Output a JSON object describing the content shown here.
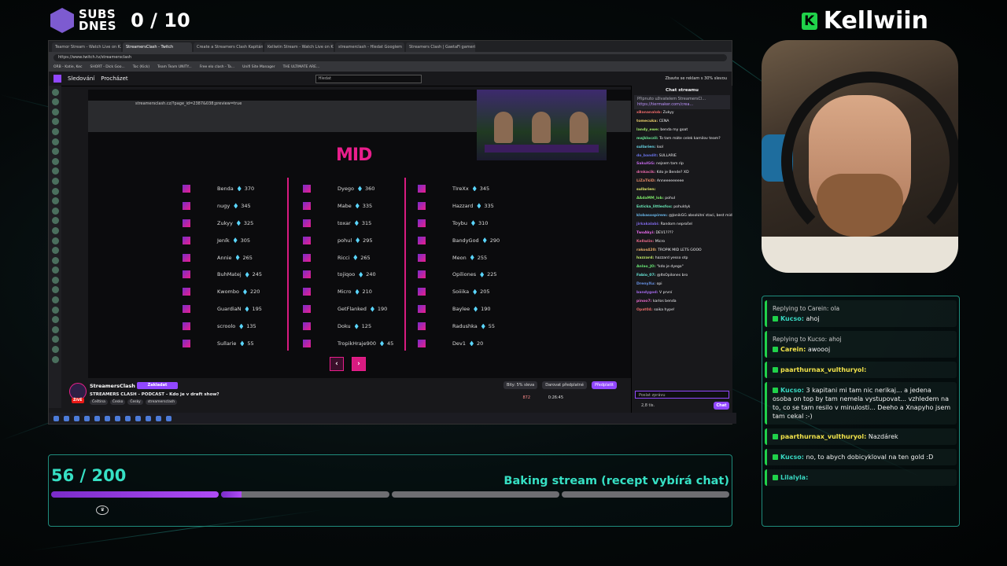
{
  "overlay": {
    "subs_label_1": "SUBS",
    "subs_label_2": "DNES",
    "subs_count": "0 / 10",
    "brand": "Kellwiin",
    "brand_icon": "K",
    "goal_progress": "56 / 200",
    "goal_fraction": 0.28,
    "goal_title": "Baking stream (recept vybírá chat)",
    "accent_color": "#36e0c4",
    "brand_color": "#20d14a"
  },
  "browser": {
    "tabs": [
      "Teamor Stream - Watch Live on K...",
      "StreamersClash - Twitch",
      "Create a Streamers Clash Kapitán",
      "Kellwiin Stream - Watch Live on K",
      "streamerclash - Hledat Googlem",
      "Streamers Clash | GaetaFi gameri..."
    ],
    "url": "https://www.twitch.tv/streamersclash",
    "bookmarks": [
      "ORB - Katie, Kec",
      "SHORT - Dick Goo...",
      "Toc (Kick)",
      "Team Team UNITY...",
      "Free elo clash - Ta...",
      "Unifi Site Manager",
      "THE ULTIMATE ARE..."
    ]
  },
  "twitch": {
    "nav_following": "Sledování",
    "nav_browse": "Procházet",
    "search_placeholder": "Hledat",
    "promo": "Zbavte se reklam s 30% slevou",
    "inner_url": "streamersclash.cz/?page_id=2387&038;preview=true",
    "mid_title": "MID",
    "columns": [
      [
        [
          "Benda",
          "370"
        ],
        [
          "nugy",
          "345"
        ],
        [
          "Zukyy",
          "325"
        ],
        [
          "Jeník",
          "305"
        ],
        [
          "Annie",
          "265"
        ],
        [
          "BuhMatej",
          "245"
        ],
        [
          "Kwombo",
          "220"
        ],
        [
          "GuardiaN",
          "195"
        ],
        [
          "scroolo",
          "135"
        ],
        [
          "Sullarie",
          "55"
        ]
      ],
      [
        [
          "Dyego",
          "360"
        ],
        [
          "Mabe",
          "335"
        ],
        [
          "toxar",
          "315"
        ],
        [
          "pohul",
          "295"
        ],
        [
          "Ricci",
          "265"
        ],
        [
          "tojiqoo",
          "240"
        ],
        [
          "Micro",
          "210"
        ],
        [
          "GetFlanked",
          "190"
        ],
        [
          "Doku",
          "125"
        ],
        [
          "TropikHraje900",
          "45"
        ]
      ],
      [
        [
          "TIreXx",
          "345"
        ],
        [
          "Hazzard",
          "335"
        ],
        [
          "Toybu",
          "310"
        ],
        [
          "BandyGod",
          "290"
        ],
        [
          "Meon",
          "255"
        ],
        [
          "Opiliones",
          "225"
        ],
        [
          "Soiiika",
          "205"
        ],
        [
          "Baylee",
          "190"
        ],
        [
          "Radushka",
          "55"
        ],
        [
          "Dev1",
          "20"
        ]
      ]
    ],
    "prev_label": "‹",
    "next_label": "›",
    "channel": "StreamersClash",
    "follow_label": "Zakladat",
    "stream_title": "STREAMERS CLASH - PODCAST - Kdo je v draft show?",
    "live_label": "ŽIVĚ",
    "tags": [
      "Čeština",
      "Česko",
      "Česky",
      "streamersclash"
    ],
    "viewers": "872",
    "uptime": "0:26:45",
    "bits_label": "Bity: 5% sleva",
    "gift_label": "Darovat předplatné",
    "sub_label": "Předplatit"
  },
  "twitch_chat": {
    "title": "Chat streamu",
    "pinned_by": "Připnuto uživatelem StreamersCl...",
    "pinned_link": "https://tiermaker.com/crea...",
    "messages": [
      [
        "xBananalob:",
        "Zukyy"
      ],
      [
        "tomecuka:",
        "CENA"
      ],
      [
        "landy_ewe:",
        "benda my goat"
      ],
      [
        "majkloczil:",
        "To tam máte celek kamilov team?"
      ],
      [
        "sullarien:",
        "lool"
      ],
      [
        "do_bandit:",
        "SULLARIE"
      ],
      [
        "SakulGG:",
        "nejsem tam rip"
      ],
      [
        "drnkacik:",
        "Kdo je Bende? XD"
      ],
      [
        "LiZaTkiD:",
        "Anneeeeeeeee"
      ],
      [
        "sullarien:",
        ""
      ],
      [
        "AAdaMM_lob:",
        "pohul"
      ],
      [
        "Esticka_littlesfox:",
        "pohuldyk"
      ],
      [
        "klobasospirem:",
        "@JonikGG absolútní staci, best midlaner na seznamu"
      ],
      [
        "jirkakalabi:",
        "Random neprošel"
      ],
      [
        "TwoAkyi:",
        "DEV1????"
      ],
      [
        "Kellwiin:",
        "Micro"
      ],
      [
        "rakos420:",
        "TROPIK MID LETS GOOO"
      ],
      [
        "hazzard:",
        "hazzard yesso otp"
      ],
      [
        "Anlao_JO:",
        "\"kdo je dyego\""
      ],
      [
        "Fabio_07:",
        "@ItsOpilones bro"
      ],
      [
        "DrenyXu:",
        "opi"
      ],
      [
        "bandygod:",
        "V první"
      ],
      [
        "pinoo7:",
        "karlos benda"
      ],
      [
        "Opat04:",
        "soika hype!"
      ]
    ],
    "input_placeholder": "Poslat zprávu",
    "points": "2,8 tis.",
    "chat_button": "Chat"
  },
  "overlay_chat": [
    {
      "reply": "Replying to Carein: ola",
      "user": "Kucso:",
      "text": "ahoj",
      "color": "#38d6c0"
    },
    {
      "reply": "Replying to Kucso: ahoj",
      "user": "Carein:",
      "text": "awoooj",
      "color": "#f2e34a"
    },
    {
      "reply": "",
      "user": "paarthurnax_vulthuryol:",
      "text": "",
      "color": "#f2e34a"
    },
    {
      "reply": "",
      "user": "Kucso:",
      "text": "3 kapitani mi tam nic nerikaj... a jedena osoba on top by tam nemela vystupovat... vzhledem na to, co se tam resilo v minulosti... Deeho a Xnapyho jsem tam cekal :-)",
      "color": "#38d6c0"
    },
    {
      "reply": "",
      "user": "paarthurnax_vulthuryol:",
      "text": "Nazdárek",
      "color": "#f2e34a"
    },
    {
      "reply": "",
      "user": "Kucso:",
      "text": "no, to abych dobicykloval na ten gold :D",
      "color": "#38d6c0"
    },
    {
      "reply": "",
      "user": "Lilalyla:",
      "text": "",
      "color": "#38d6c0"
    }
  ]
}
